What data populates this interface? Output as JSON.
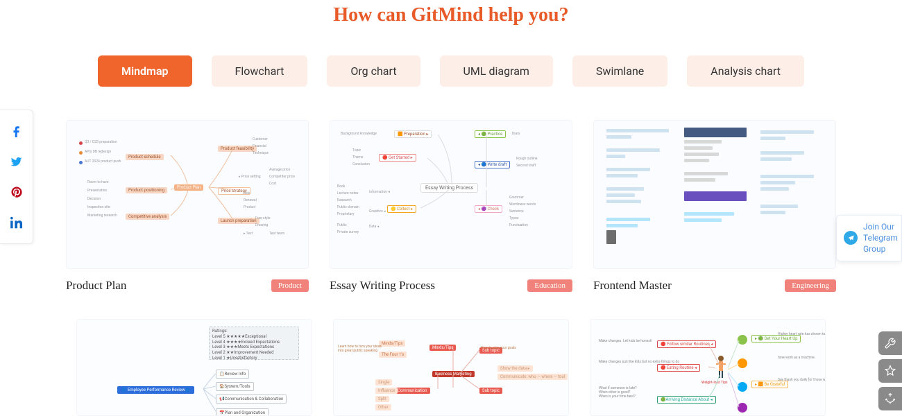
{
  "heading": "How can GitMind help you?",
  "tabs": [
    {
      "label": "Mindmap",
      "active": true
    },
    {
      "label": "Flowchart",
      "active": false
    },
    {
      "label": "Org chart",
      "active": false
    },
    {
      "label": "UML diagram",
      "active": false
    },
    {
      "label": "Swimlane",
      "active": false
    },
    {
      "label": "Analysis chart",
      "active": false
    }
  ],
  "templates_row1": [
    {
      "title": "Product Plan",
      "tag": "Product"
    },
    {
      "title": "Essay Writing Process",
      "tag": "Education"
    },
    {
      "title": "Frontend Master",
      "tag": "Engineering"
    }
  ],
  "social": {
    "facebook": "facebook",
    "twitter": "twitter",
    "pinterest": "pinterest",
    "linkedin": "linkedin"
  },
  "telegram_cta": "Join Our Telegram Group",
  "tools": {
    "settings": "settings",
    "favorite": "favorite",
    "feedback": "feedback"
  }
}
